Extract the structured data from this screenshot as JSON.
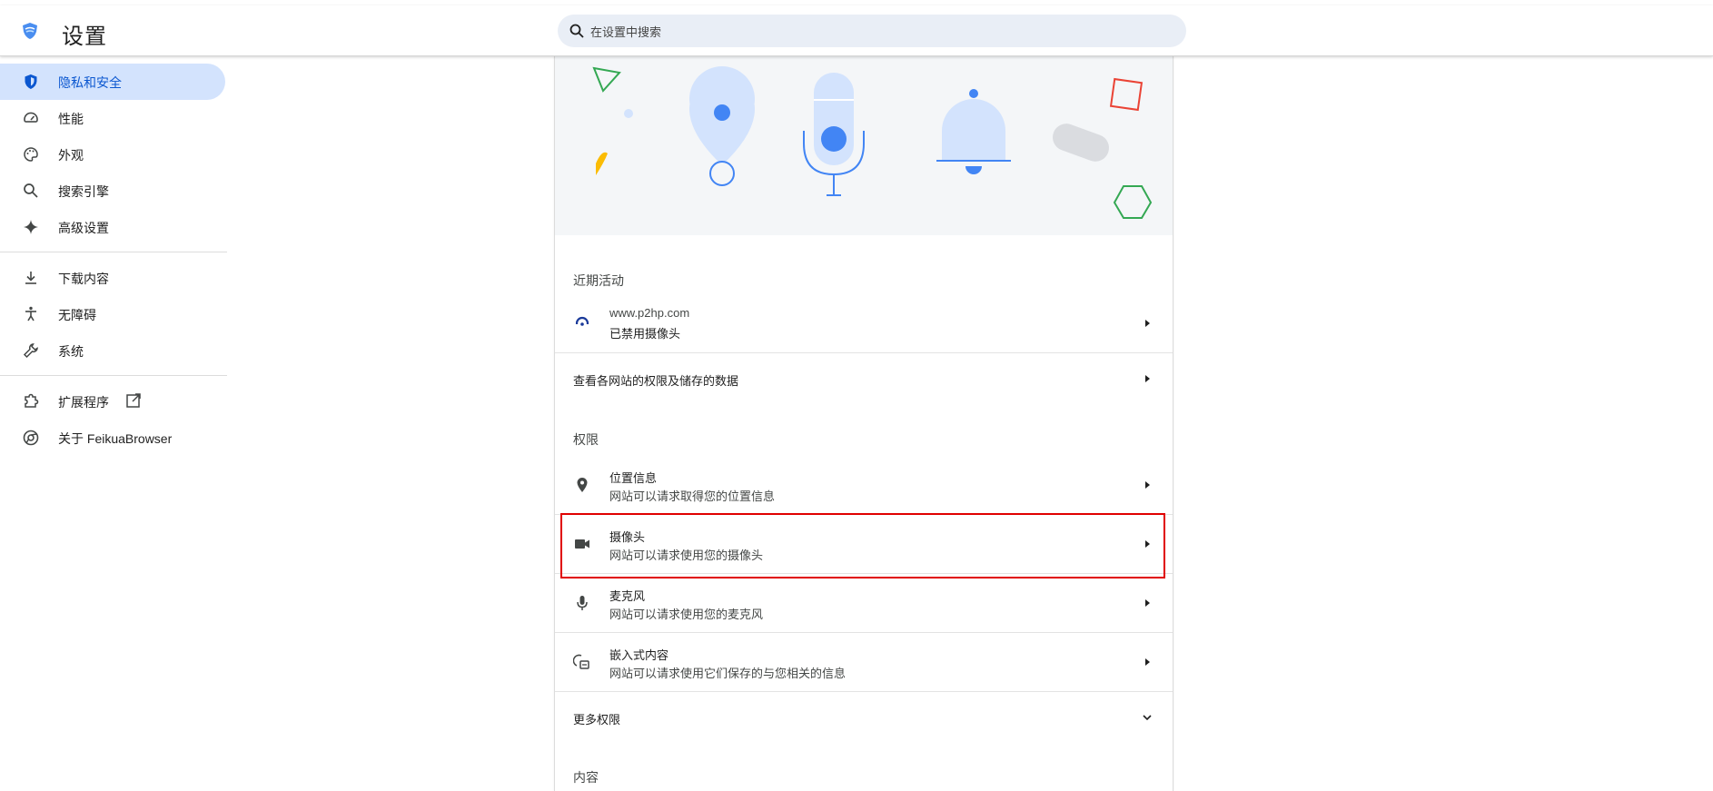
{
  "header": {
    "title": "设置",
    "search_placeholder": "在设置中搜索"
  },
  "sidebar": {
    "items": [
      {
        "label": "隐私和安全",
        "icon": "shield-icon",
        "active": true
      },
      {
        "label": "性能",
        "icon": "speedometer-icon"
      },
      {
        "label": "外观",
        "icon": "palette-icon"
      },
      {
        "label": "搜索引擎",
        "icon": "search-icon"
      },
      {
        "label": "高级设置",
        "icon": "sparkle-icon"
      },
      {
        "label": "下载内容",
        "icon": "download-icon"
      },
      {
        "label": "无障碍",
        "icon": "accessibility-icon"
      },
      {
        "label": "系统",
        "icon": "wrench-icon"
      },
      {
        "label": "扩展程序",
        "icon": "puzzle-icon"
      },
      {
        "label": "关于 FeikuaBrowser",
        "icon": "browser-logo-icon"
      }
    ]
  },
  "main": {
    "recent_label": "近期活动",
    "recent_item": {
      "title": "www.p2hp.com",
      "subtitle": "已禁用摄像头"
    },
    "all_sites_label": "查看各网站的权限及储存的数据",
    "permissions_label": "权限",
    "permissions": [
      {
        "title": "位置信息",
        "subtitle": "网站可以请求取得您的位置信息",
        "icon": "location-pin-icon"
      },
      {
        "title": "摄像头",
        "subtitle": "网站可以请求使用您的摄像头",
        "icon": "camera-icon"
      },
      {
        "title": "麦克风",
        "subtitle": "网站可以请求使用您的麦克风",
        "icon": "microphone-icon"
      },
      {
        "title": "嵌入式内容",
        "subtitle": "网站可以请求使用它们保存的与您相关的信息",
        "icon": "embedded-content-icon"
      }
    ],
    "more_permissions_label": "更多权限",
    "content_label": "内容"
  },
  "colors": {
    "accent": "#0b57d0",
    "active_bg": "#d3e3fd",
    "highlight_border": "#e00000",
    "illustration_blue": "#d3e3fd",
    "illustration_dot": "#4285f4"
  }
}
